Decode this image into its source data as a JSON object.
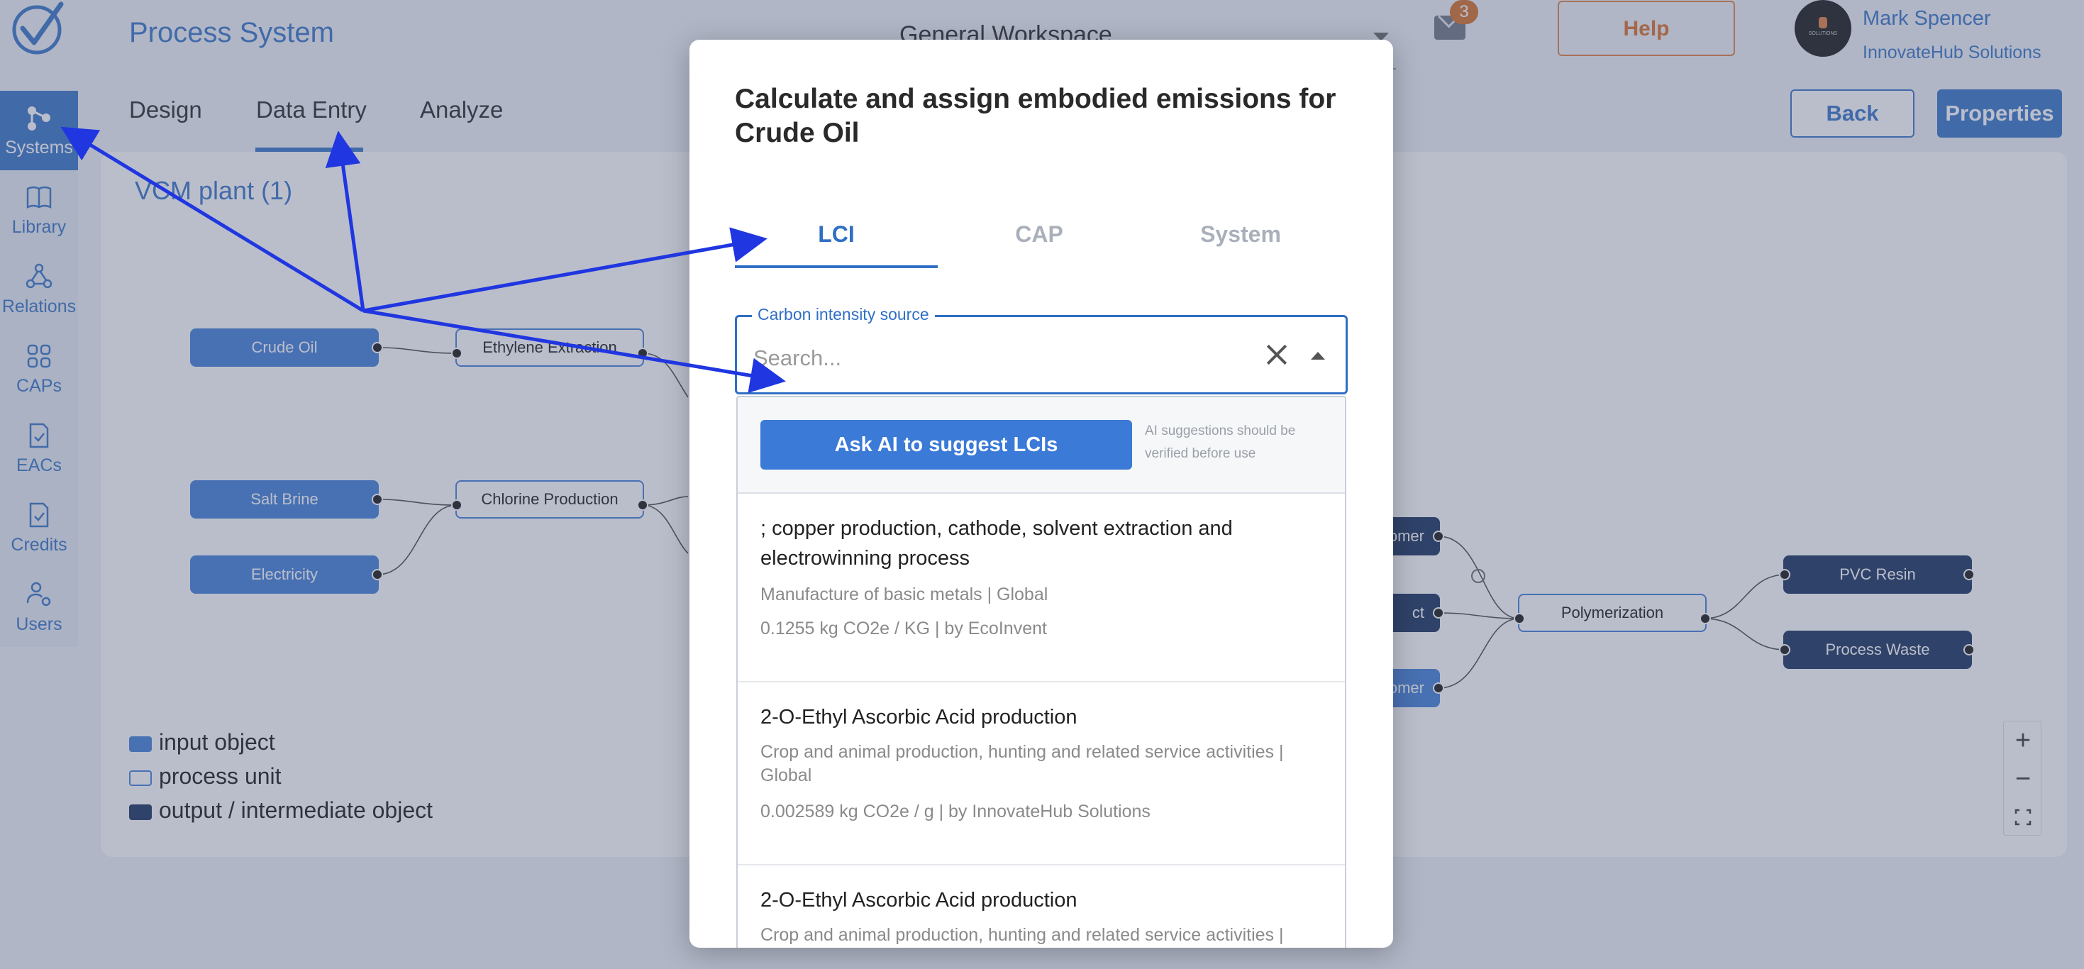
{
  "app": {
    "title": "Process System",
    "workspace": "General Workspace",
    "mail_count": "3",
    "help_label": "Help",
    "user_name": "Mark Spencer",
    "user_org": "InnovateHub Solutions",
    "avatar_text": "SOLUTIONS"
  },
  "sidebar": {
    "items": [
      {
        "label": "Systems",
        "icon": "systems-icon"
      },
      {
        "label": "Library",
        "icon": "book-icon"
      },
      {
        "label": "Relations",
        "icon": "relations-icon"
      },
      {
        "label": "CAPs",
        "icon": "grid-icon"
      },
      {
        "label": "EACs",
        "icon": "doc-check-icon"
      },
      {
        "label": "Credits",
        "icon": "doc-check-icon"
      },
      {
        "label": "Users",
        "icon": "users-gear-icon"
      }
    ]
  },
  "tabs": [
    "Design",
    "Data Entry",
    "Analyze"
  ],
  "buttons": {
    "back": "Back",
    "properties": "Properties"
  },
  "canvas": {
    "title": "VCM plant (1)",
    "nodes": {
      "crude_oil": "Crude Oil",
      "ethylene_extraction": "Ethylene Extraction",
      "salt_brine": "Salt Brine",
      "chlorine_production": "Chlorine Production",
      "electricity": "Electricity",
      "monomer_1": "omer",
      "product": "ct",
      "monomer_2": "omer",
      "polymerization": "Polymerization",
      "pvc_resin": "PVC Resin",
      "process_waste": "Process Waste"
    }
  },
  "legend": [
    "input object",
    "process unit",
    "output / intermediate object"
  ],
  "zoom": {
    "in": "+",
    "out": "−"
  },
  "dialog": {
    "title": "Calculate and assign embodied emissions for Crude Oil",
    "tabs": [
      "LCI",
      "CAP",
      "System"
    ],
    "field_label": "Carbon intensity source",
    "search_placeholder": "Search...",
    "ai_button": "Ask AI to suggest LCIs",
    "ai_note": "AI suggestions should be verified before use",
    "options": [
      {
        "name": "; copper production, cathode, solvent extraction and electrowinning process",
        "category": "Manufacture of basic metals | Global",
        "value": "0.1255 kg CO2e / KG | by EcoInvent"
      },
      {
        "name": "2-O-Ethyl Ascorbic Acid production",
        "category": "Crop and animal production, hunting and related service activities | Global",
        "value": "0.002589 kg CO2e / g | by InnovateHub Solutions"
      },
      {
        "name": "2-O-Ethyl Ascorbic Acid production",
        "category": "Crop and animal production, hunting and related service activities |"
      }
    ]
  },
  "colors": {
    "accent": "#2f6fc4",
    "input": "#3b7ad6",
    "output": "#102a56",
    "help": "#e07a3a",
    "arrow": "#1f36e0"
  }
}
